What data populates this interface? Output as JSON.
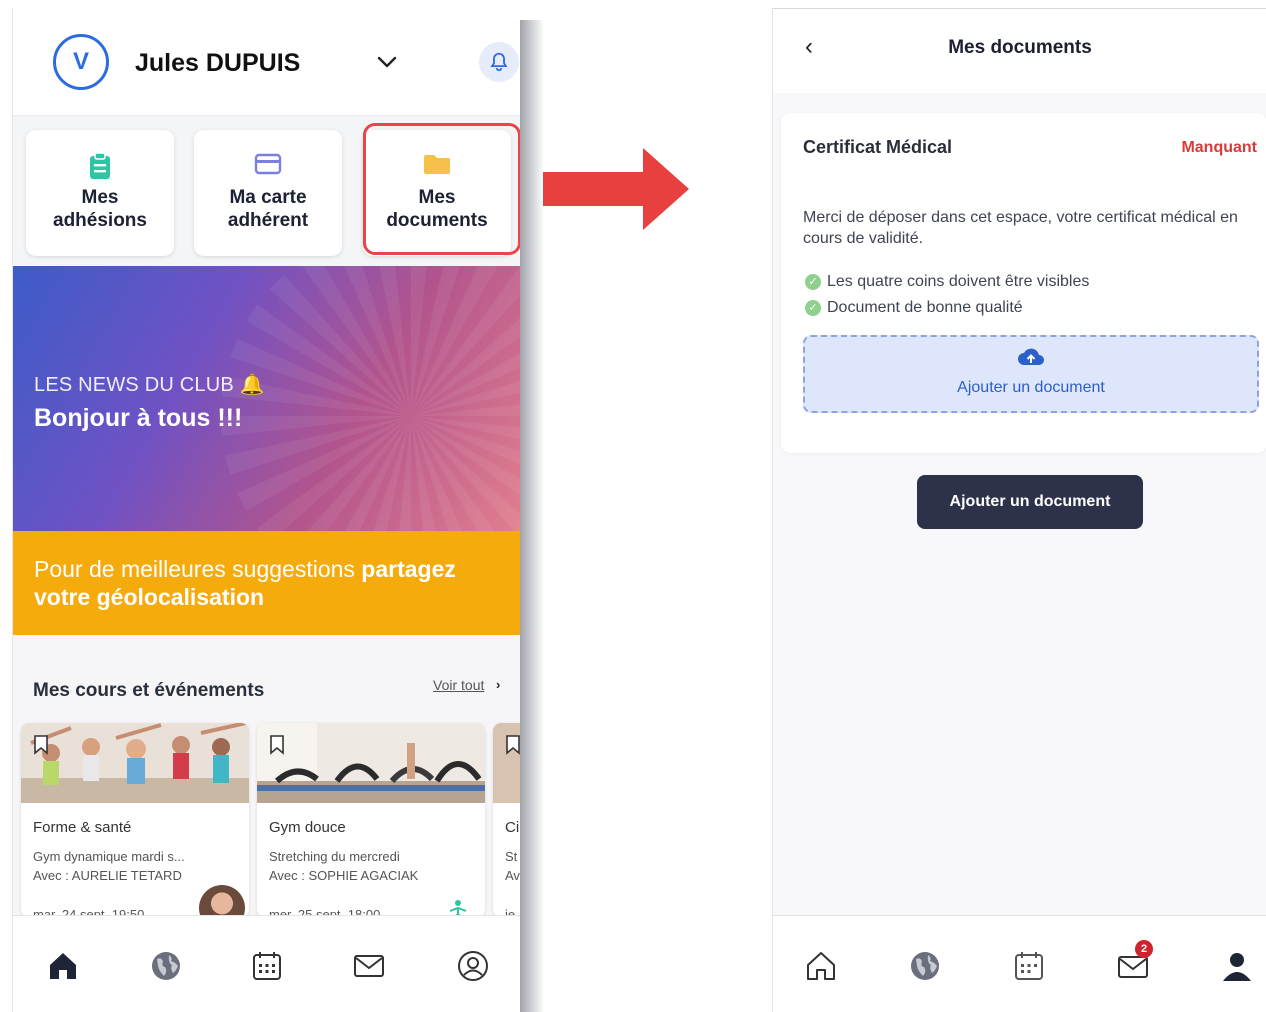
{
  "left": {
    "header": {
      "avatar_letter": "V",
      "user_name": "Jules DUPUIS",
      "accent": "#2d6cdf"
    },
    "tiles": [
      {
        "line1": "Mes",
        "line2": "adhésions",
        "icon": "clipboard-icon",
        "color": "#2fc4a4"
      },
      {
        "line1": "Ma carte",
        "line2": "adhérent",
        "icon": "card-icon",
        "color": "#7b7fe0"
      },
      {
        "line1": "Mes",
        "line2": "documents",
        "icon": "folder-icon",
        "color": "#f7c04a",
        "highlighted": true
      }
    ],
    "news": {
      "kicker": "LES NEWS DU CLUB",
      "title": "Bonjour à tous !!!"
    },
    "geo": {
      "text": "Pour de meilleures suggestions ",
      "bold1": "partagez",
      "bold2": "votre géolocalisation",
      "color": "#f6ab0d"
    },
    "courses": {
      "title": "Mes cours et événements",
      "see_all": "Voir tout",
      "cards": [
        {
          "title": "Forme & santé",
          "subtitle": "Gym dynamique mardi s...",
          "coach": "Avec : AURELIE TETARD",
          "date": "mar. 24 sept. 19:50"
        },
        {
          "title": "Gym douce",
          "subtitle": "Stretching du mercredi",
          "coach": "Avec : SOPHIE AGACIAK",
          "date": "mer. 25 sept. 18:00"
        },
        {
          "title": "Ci",
          "subtitle": "St",
          "coach": "Av",
          "date": "je"
        }
      ]
    },
    "nav": [
      "home-icon",
      "globe-icon",
      "calendar-icon",
      "mail-icon",
      "profile-icon"
    ]
  },
  "right": {
    "header": {
      "title": "Mes documents"
    },
    "document": {
      "name": "Certificat Médical",
      "status": "Manquant",
      "status_color": "#d93a3a",
      "description": "Merci de déposer dans cet espace, votre certificat médical en cours de validité.",
      "checks": [
        "Les quatre coins doivent être visibles",
        "Document de bonne qualité"
      ],
      "drop_label": "Ajouter un document"
    },
    "button_label": "Ajouter un document",
    "nav": [
      "home-icon",
      "globe-icon",
      "calendar-icon",
      "mail-icon",
      "person-icon"
    ],
    "mail_badge": "2"
  }
}
